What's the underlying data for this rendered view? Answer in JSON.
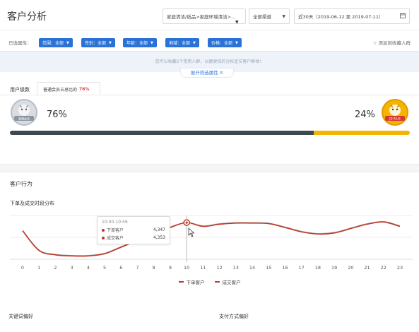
{
  "header": {
    "title": "客户分析",
    "category_select": "家庭清洁/纸品>家庭环境清洁>...",
    "channel_select": "全部渠道",
    "date_select": "近30天（2019-06-12 至 2019-07-11）"
  },
  "filters": {
    "label": "已选属性：",
    "chips": [
      {
        "label": "范围：全部"
      },
      {
        "label": "性别：全部"
      },
      {
        "label": "年龄：全部"
      },
      {
        "label": "地域：全部"
      },
      {
        "label": "价格：全部"
      }
    ],
    "add_link": "☆ 添加到收藏人群"
  },
  "info": {
    "text": "您可以收藏5个常用人群，以便更快的分析定位客户群体！",
    "expand_link": "展开筛选属性 ≡"
  },
  "user_level": {
    "label": "用户级数",
    "tab_text": "普通会员占总比的",
    "tab_percent": "76%",
    "standard_badge_text": "普通会员",
    "plus_badge_text": "JD PLUS",
    "standard_percent": "76%",
    "plus_percent": "24%",
    "standard_share": 0.76,
    "plus_share": 0.24,
    "colors": {
      "standard": "#3d4852",
      "plus": "#f4b400"
    }
  },
  "behavior": {
    "title": "客户行为",
    "chart_title": "下单及成交时段分布"
  },
  "chart_data": {
    "type": "line",
    "x": [
      0,
      1,
      2,
      3,
      4,
      5,
      6,
      7,
      8,
      9,
      10,
      11,
      12,
      13,
      14,
      15,
      16,
      17,
      18,
      19,
      20,
      21,
      22,
      23
    ],
    "series": [
      {
        "name": "下单客户",
        "values": [
          3600,
          1800,
          1400,
          1300,
          1300,
          1500,
          2100,
          2700,
          3300,
          3900,
          4347,
          4000,
          4200,
          4300,
          4300,
          4250,
          3900,
          3500,
          3300,
          3400,
          3800,
          4200,
          4400,
          4000
        ],
        "color": "#c0392b"
      },
      {
        "name": "成交客户",
        "values": [
          3650,
          1850,
          1450,
          1350,
          1350,
          1550,
          2150,
          2750,
          3350,
          3950,
          4353,
          4050,
          4250,
          4350,
          4350,
          4300,
          3950,
          3550,
          3350,
          3450,
          3850,
          4250,
          4450,
          4050
        ],
        "color": "#5a5a5a"
      }
    ],
    "ylim": [
      1000,
      5000
    ],
    "grid": true,
    "legend": "bottom",
    "tooltip": {
      "time": "10:00-10:59",
      "rows": [
        {
          "label": "下单客户",
          "value": "4,347"
        },
        {
          "label": "成交客户",
          "value": "4,353"
        }
      ]
    },
    "highlight_x": 10
  },
  "bottom": {
    "keyword_title": "关键词偏好",
    "payment_title": "支付方式偏好"
  }
}
